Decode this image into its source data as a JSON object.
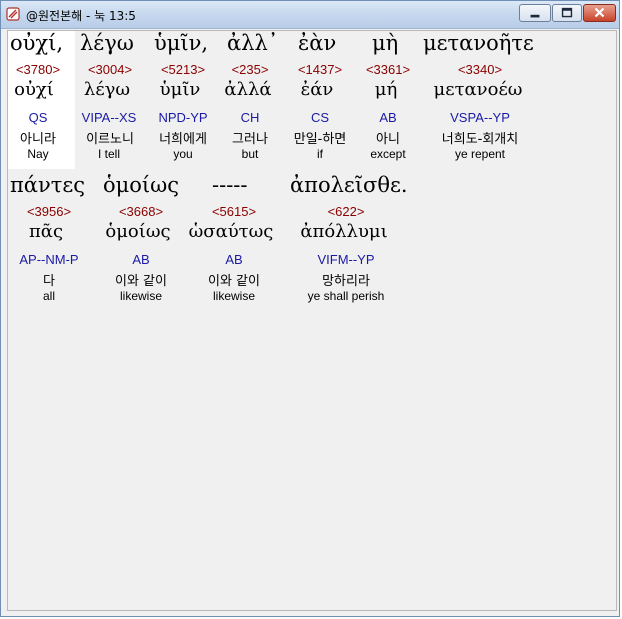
{
  "window": {
    "title": "@원전본해 - 눅 13:5"
  },
  "lines": [
    {
      "words": [
        {
          "surface": "οὐχί,",
          "strong": "<3780>",
          "lemma": "οὐχί",
          "morph": "QS",
          "korean": "아니라",
          "english": "Nay"
        },
        {
          "surface": "λέγω",
          "strong": "<3004>",
          "lemma": "λέγω",
          "morph": "VIPA--XS",
          "korean": "이르노니",
          "english": "I tell"
        },
        {
          "surface": "ὑμῖν,",
          "strong": "<5213>",
          "lemma": "ὑμῖν",
          "morph": "NPD-YP",
          "korean": "너희에게",
          "english": "you"
        },
        {
          "surface": "ἀλλ᾽",
          "strong": "<235>",
          "lemma": "ἀλλά",
          "morph": "CH",
          "korean": "그러나",
          "english": "but"
        },
        {
          "surface": "ἐὰν",
          "strong": "<1437>",
          "lemma": "ἐάν",
          "morph": "CS",
          "korean": "만일-하면",
          "english": "if"
        },
        {
          "surface": "μὴ",
          "strong": "<3361>",
          "lemma": "μή",
          "morph": "AB",
          "korean": "아니",
          "english": "except"
        },
        {
          "surface": "μετανοῆτε",
          "strong": "<3340>",
          "lemma": "μετανοέω",
          "morph": "VSPA--YP",
          "korean": "너희도-회개치",
          "english": "ye repent"
        }
      ]
    },
    {
      "words": [
        {
          "surface": "πάντες",
          "strong": "<3956>",
          "lemma": "πᾶς",
          "morph": "AP--NM-P",
          "korean": "다",
          "english": "all"
        },
        {
          "surface": "ὁμοίως",
          "strong": "<3668>",
          "lemma": "ὁμοίως",
          "morph": "AB",
          "korean": "이와 같이",
          "english": "likewise"
        },
        {
          "surface": "-----",
          "strong": "<5615>",
          "lemma": "ὡσαύτως",
          "morph": "AB",
          "korean": "이와 같이",
          "english": "likewise"
        },
        {
          "surface": "ἀπολεῖσθε.",
          "strong": "<622>",
          "lemma": "ἀπόλλυμι",
          "morph": "VIFM--YP",
          "korean": "망하리라",
          "english": "ye shall perish"
        }
      ]
    }
  ],
  "colors": {
    "strong": "#8b0000",
    "morph": "#1a1aa6",
    "selected_bg": "#ffffff"
  },
  "icons": {
    "app": "bible-app-icon",
    "minimize": "minimize-icon",
    "maximize": "maximize-icon",
    "close": "close-icon"
  }
}
